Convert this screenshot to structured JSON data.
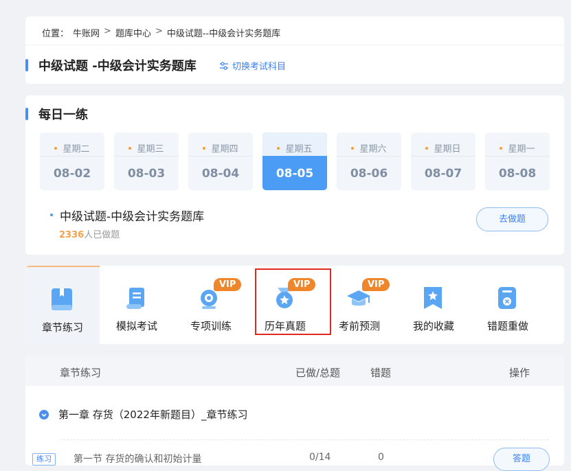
{
  "breadcrumb": {
    "prefix": "位置：",
    "items": [
      "牛账网",
      "题库中心",
      "中级试题--中级会计实务题库"
    ],
    "separator": ">"
  },
  "header": {
    "title": "中级试题 -中级会计实务题库",
    "switch_label": "切换考试科目"
  },
  "daily": {
    "title": "每日一练",
    "days": [
      {
        "weekday": "星期二",
        "date": "08-02"
      },
      {
        "weekday": "星期三",
        "date": "08-03"
      },
      {
        "weekday": "星期四",
        "date": "08-04"
      },
      {
        "weekday": "星期五",
        "date": "08-05"
      },
      {
        "weekday": "星期六",
        "date": "08-06"
      },
      {
        "weekday": "星期日",
        "date": "08-07"
      },
      {
        "weekday": "星期一",
        "date": "08-08"
      }
    ],
    "practice_title": "中级试题-中级会计实务题库",
    "done_count": "2336",
    "done_suffix": "人已做题",
    "do_button": "去做题"
  },
  "modules": {
    "vip_label": "VIP",
    "items": [
      {
        "label": "章节练习"
      },
      {
        "label": "模拟考试"
      },
      {
        "label": "专项训练"
      },
      {
        "label": "历年真题"
      },
      {
        "label": "考前预测"
      },
      {
        "label": "我的收藏"
      },
      {
        "label": "错题重做"
      }
    ]
  },
  "table": {
    "headers": {
      "name": "章节练习",
      "progress": "已做/总题",
      "wrong": "错题",
      "action": "操作"
    },
    "chapter": "第一章 存货（2022年新题目）_章节练习",
    "sub": {
      "tag": "练习",
      "name": "第一节 存货的确认和初始计量",
      "progress": "0/14",
      "wrong": "0",
      "button": "答题"
    }
  },
  "colors": {
    "accent": "#4a9cf5",
    "vip": "#f0862b",
    "highlight": "#e0281f"
  }
}
